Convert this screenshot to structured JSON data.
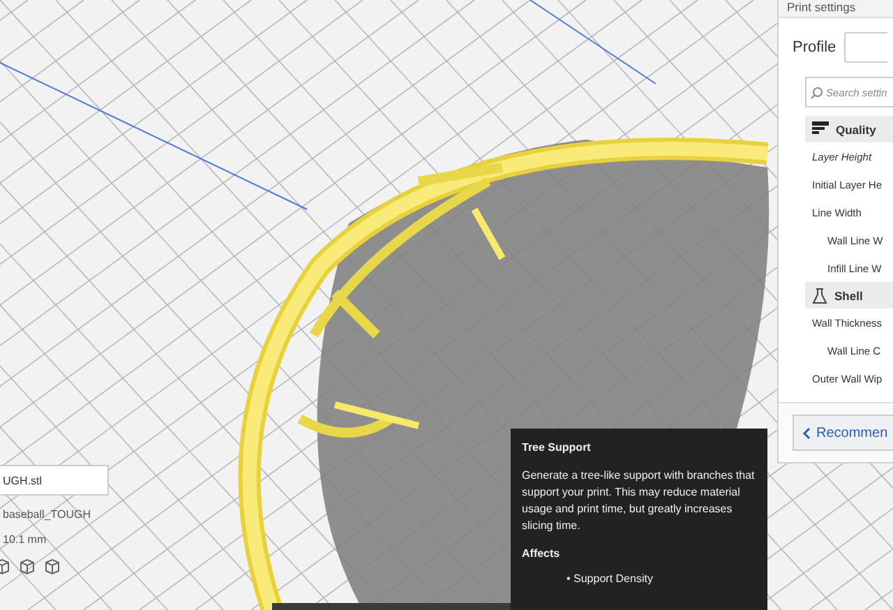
{
  "print_settings": {
    "title": "Print settings",
    "profile_label": "Profile",
    "search": {
      "placeholder": "Search settin"
    },
    "categories": [
      {
        "kind": "quality",
        "label": "Quality",
        "settings": [
          {
            "label": "Layer Height",
            "modified": true
          },
          {
            "label": "Initial Layer He",
            "modified": false
          },
          {
            "label": "Line Width",
            "modified": false,
            "children": [
              {
                "label": "Wall Line W",
                "modified": false
              },
              {
                "label": "Infill Line W",
                "modified": false
              }
            ]
          }
        ]
      },
      {
        "kind": "shell",
        "label": "Shell",
        "settings": [
          {
            "label": "Wall Thickness",
            "modified": false,
            "children": [
              {
                "label": "Wall Line C",
                "modified": false
              }
            ]
          },
          {
            "label": "Outer Wall Wip",
            "modified": false
          }
        ]
      }
    ],
    "recommended_button": "Recommen"
  },
  "tooltip": {
    "title": "Tree Support",
    "description": "Generate a tree-like support with branches that support your print. This may reduce material usage and print time, but greatly increases slicing time.",
    "affects_heading": "Affects",
    "affects": [
      "• Support Density"
    ]
  },
  "object_info": {
    "file_name": "UGH.stl",
    "profile": "baseball_TOUGH",
    "dimension": "10.1 mm"
  }
}
